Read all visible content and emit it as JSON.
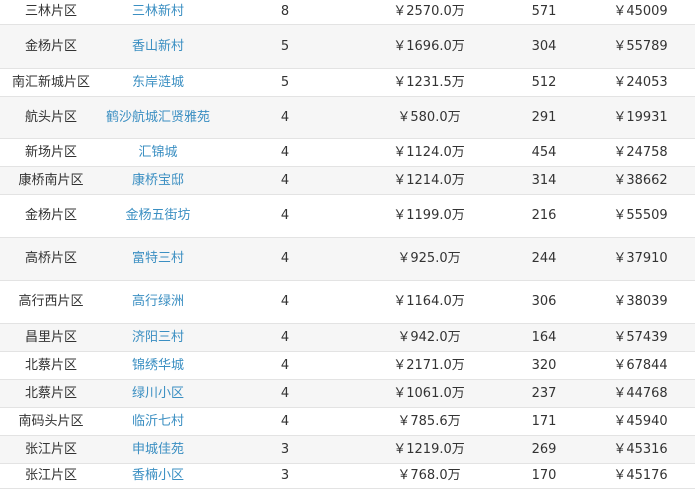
{
  "table": {
    "rows": [
      {
        "district": "三林片区",
        "community": "三林新村",
        "count": "8",
        "total": "￥2570.0万",
        "area": "571",
        "unit_price": "￥45009"
      },
      {
        "district": "金杨片区",
        "community": "香山新村",
        "count": "5",
        "total": "￥1696.0万",
        "area": "304",
        "unit_price": "￥55789"
      },
      {
        "district": "南汇新城片区",
        "community": "东岸涟城",
        "count": "5",
        "total": "￥1231.5万",
        "area": "512",
        "unit_price": "￥24053"
      },
      {
        "district": "航头片区",
        "community": "鹤沙航城汇贤雅苑",
        "count": "4",
        "total": "￥580.0万",
        "area": "291",
        "unit_price": "￥19931"
      },
      {
        "district": "新场片区",
        "community": "汇锦城",
        "count": "4",
        "total": "￥1124.0万",
        "area": "454",
        "unit_price": "￥24758"
      },
      {
        "district": "康桥南片区",
        "community": "康桥宝邸",
        "count": "4",
        "total": "￥1214.0万",
        "area": "314",
        "unit_price": "￥38662"
      },
      {
        "district": "金杨片区",
        "community": "金杨五街坊",
        "count": "4",
        "total": "￥1199.0万",
        "area": "216",
        "unit_price": "￥55509"
      },
      {
        "district": "高桥片区",
        "community": "富特三村",
        "count": "4",
        "total": "￥925.0万",
        "area": "244",
        "unit_price": "￥37910"
      },
      {
        "district": "高行西片区",
        "community": "高行绿洲",
        "count": "4",
        "total": "￥1164.0万",
        "area": "306",
        "unit_price": "￥38039"
      },
      {
        "district": "昌里片区",
        "community": "济阳三村",
        "count": "4",
        "total": "￥942.0万",
        "area": "164",
        "unit_price": "￥57439"
      },
      {
        "district": "北蔡片区",
        "community": "锦绣华城",
        "count": "4",
        "total": "￥2171.0万",
        "area": "320",
        "unit_price": "￥67844"
      },
      {
        "district": "北蔡片区",
        "community": "绿川小区",
        "count": "4",
        "total": "￥1061.0万",
        "area": "237",
        "unit_price": "￥44768"
      },
      {
        "district": "南码头片区",
        "community": "临沂七村",
        "count": "4",
        "total": "￥785.6万",
        "area": "171",
        "unit_price": "￥45940"
      },
      {
        "district": "张江片区",
        "community": "申城佳苑",
        "count": "3",
        "total": "￥1219.0万",
        "area": "269",
        "unit_price": "￥45316"
      },
      {
        "district": "张江片区",
        "community": "香楠小区",
        "count": "3",
        "total": "￥768.0万",
        "area": "170",
        "unit_price": "￥45176"
      }
    ]
  }
}
